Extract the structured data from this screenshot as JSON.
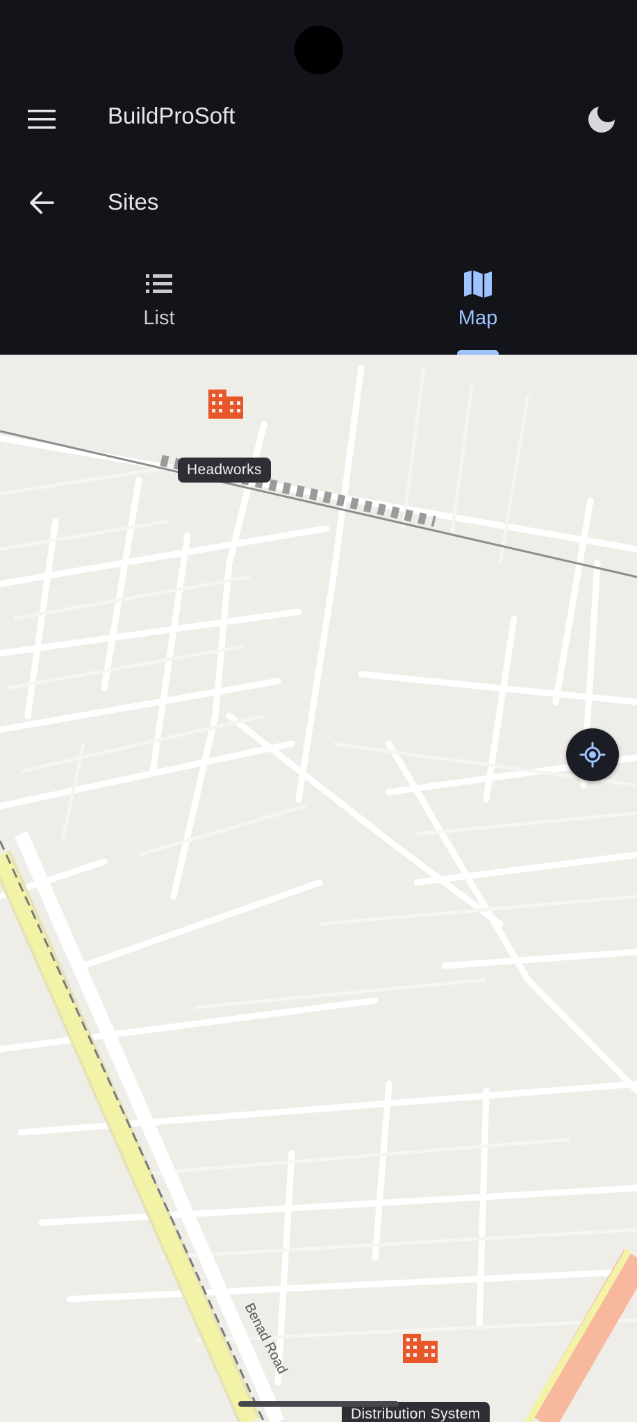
{
  "app": {
    "title": "BuildProSoft"
  },
  "header": {
    "menu_icon": "menu-icon",
    "theme_icon": "moon-icon"
  },
  "subheader": {
    "back_icon": "arrow-back-icon",
    "title": "Sites"
  },
  "tabs": [
    {
      "label": "List",
      "icon": "list-icon",
      "selected": false
    },
    {
      "label": "Map",
      "icon": "map-icon",
      "selected": true
    }
  ],
  "map": {
    "road_label": "Benad Road",
    "markers": [
      {
        "label": "Headworks",
        "icon": "building-icon"
      },
      {
        "label": "Distribution System",
        "icon": "building-icon"
      }
    ],
    "locate_icon": "my-location-icon"
  },
  "colors": {
    "background": "#12141a",
    "accent": "#9fc3ff",
    "marker": "#e8572a",
    "map_base": "#efede7"
  }
}
